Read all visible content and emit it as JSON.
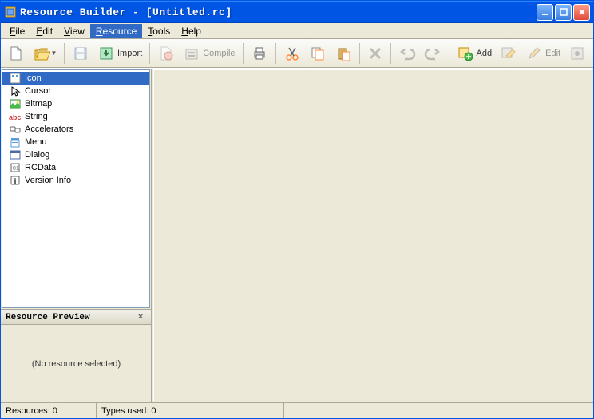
{
  "title": "Resource Builder - [Untitled.rc]",
  "menus": {
    "file": "File",
    "edit": "Edit",
    "view": "View",
    "resource": "Resource",
    "tools": "Tools",
    "help": "Help"
  },
  "toolbar": {
    "import": "Import",
    "compile": "Compile",
    "add": "Add",
    "edit": "Edit"
  },
  "tree": {
    "icon": "Icon",
    "cursor": "Cursor",
    "bitmap": "Bitmap",
    "string": "String",
    "accelerators": "Accelerators",
    "menu": "Menu",
    "dialog": "Dialog",
    "rcdata": "RCData",
    "version": "Version Info"
  },
  "preview": {
    "title": "Resource Preview",
    "empty": "(No resource selected)"
  },
  "status": {
    "resources": "Resources: 0",
    "types": "Types used: 0"
  }
}
